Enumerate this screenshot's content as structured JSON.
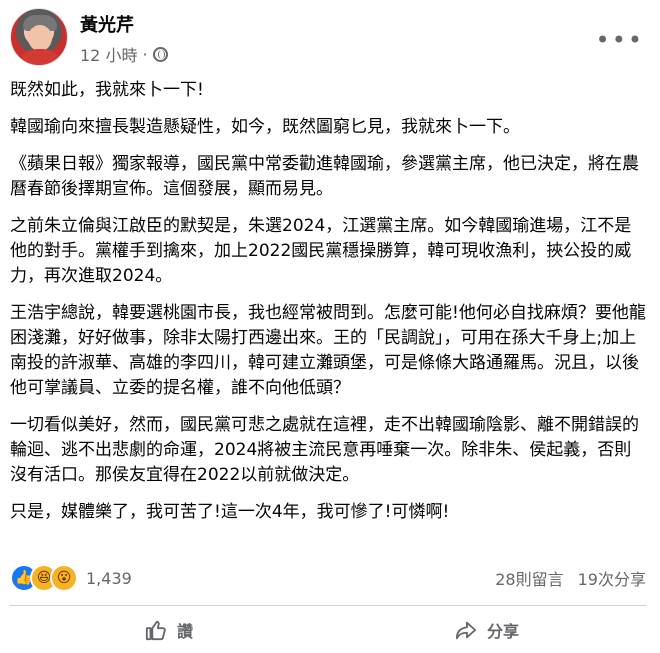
{
  "post": {
    "author": "黃光芹",
    "time": "12 小時",
    "separator": "·",
    "paragraphs": [
      "既然如此，我就來卜一下!",
      "韓國瑜向來擅長製造懸疑性，如今，既然圖窮匕見，我就來卜一下。",
      "《蘋果日報》獨家報導，國民黨中常委勸進韓國瑜，參選黨主席，他已決定，將在農曆春節後擇期宣佈。這個發展，顯而易見。",
      "之前朱立倫與江啟臣的默契是，朱選2024，江選黨主席。如今韓國瑜進場，江不是他的對手。黨權手到擒來，加上2022國民黨穩操勝算，韓可現收漁利，挾公投的威力，再次進取2024。",
      "王浩宇總說，韓要選桃園市長，我也經常被問到。怎麼可能!他何必自找麻煩？要他龍困淺灘，好好做事，除非太陽打西邊出來。王的「民調說」，可用在孫大千身上;加上南投的許淑華、高雄的李四川，韓可建立灘頭堡，可是條條大路通羅馬。況且，以後他可掌議員、立委的提名權，誰不向他低頭？",
      "一切看似美好，然而，國民黨可悲之處就在這裡，走不出韓國瑜陰影、離不開錯誤的輪迴、逃不出悲劇的命運，2024將被主流民意再唾棄一次。除非朱、侯起義，否則沒有活口。那侯友宜得在2022以前就做決定。",
      "只是，媒體樂了，我可苦了!這一次4年，我可慘了!可憐啊!"
    ]
  },
  "stats": {
    "reaction_count": "1,439",
    "comments": "28則留言",
    "shares": "19次分享"
  },
  "actions": {
    "like": "讚",
    "share": "分享"
  },
  "colors": {
    "like_blue": "#1877f2",
    "reaction_yellow": "#f7b125",
    "muted_text": "#65676b"
  }
}
